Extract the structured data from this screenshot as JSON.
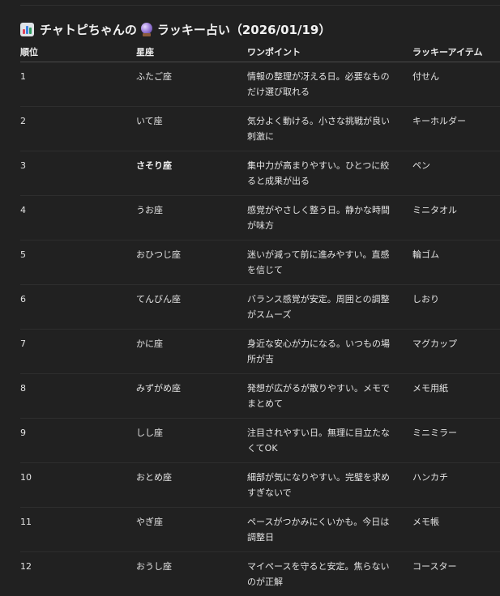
{
  "heading": {
    "icon": "bar-chart-icon",
    "title_part1": "チャトピちゃんの",
    "icon2": "crystal-ball-icon",
    "title_part2": "ラッキー占い（2026/01/19）"
  },
  "table": {
    "headers": [
      "順位",
      "星座",
      "ワンポイント",
      "ラッキーアイテム"
    ],
    "rows": [
      {
        "rank": "1",
        "sign": "ふたご座",
        "point": "情報の整理が冴える日。必要なものだけ選び取れる",
        "item": "付せん"
      },
      {
        "rank": "2",
        "sign": "いて座",
        "point": "気分よく動ける。小さな挑戦が良い刺激に",
        "item": "キーホルダー"
      },
      {
        "rank": "3",
        "sign": "さそり座",
        "point": "集中力が高まりやすい。ひとつに絞ると成果が出る",
        "item": "ペン"
      },
      {
        "rank": "4",
        "sign": "うお座",
        "point": "感覚がやさしく整う日。静かな時間が味方",
        "item": "ミニタオル"
      },
      {
        "rank": "5",
        "sign": "おひつじ座",
        "point": "迷いが減って前に進みやすい。直感を信じて",
        "item": "輪ゴム"
      },
      {
        "rank": "6",
        "sign": "てんびん座",
        "point": "バランス感覚が安定。周囲との調整がスムーズ",
        "item": "しおり"
      },
      {
        "rank": "7",
        "sign": "かに座",
        "point": "身近な安心が力になる。いつもの場所が吉",
        "item": "マグカップ"
      },
      {
        "rank": "8",
        "sign": "みずがめ座",
        "point": "発想が広がるが散りやすい。メモでまとめて",
        "item": "メモ用紙"
      },
      {
        "rank": "9",
        "sign": "しし座",
        "point": "注目されやすい日。無理に目立たなくてOK",
        "item": "ミニミラー"
      },
      {
        "rank": "10",
        "sign": "おとめ座",
        "point": "細部が気になりやすい。完璧を求めすぎないで",
        "item": "ハンカチ"
      },
      {
        "rank": "11",
        "sign": "やぎ座",
        "point": "ペースがつかみにくいかも。今日は調整日",
        "item": "メモ帳"
      },
      {
        "rank": "12",
        "sign": "おうし座",
        "point": "マイペースを守ると安定。焦らないのが正解",
        "item": "コースター"
      }
    ]
  }
}
